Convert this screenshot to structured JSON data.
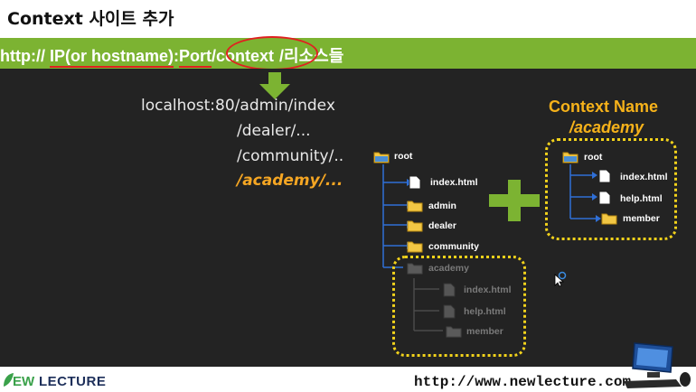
{
  "title": "Context 사이트 추가",
  "url_bar": {
    "prefix": "http:// ",
    "host": "IP(or hostname)",
    "colon": ":",
    "port": "Port",
    "context": "/context",
    "resources": "/리소스들"
  },
  "example_paths": [
    "localhost:80/admin/index",
    "/dealer/...",
    "/community/..",
    "/academy/..."
  ],
  "context_name": {
    "title": "Context Name",
    "value": "/academy"
  },
  "left_tree": {
    "root": "root",
    "items": [
      "index.html",
      "admin",
      "dealer",
      "community"
    ],
    "dim_folder": "academy",
    "dim_items": [
      "index.html",
      "help.html",
      "member"
    ]
  },
  "right_tree": {
    "root": "root",
    "items": [
      "index.html",
      "help.html",
      "member"
    ]
  },
  "footer": {
    "logo_ew": "EW",
    "logo_lecture": "LECTURE",
    "website": "http://www.newlecture.com"
  },
  "colors": {
    "green_bar": "#7cb332",
    "accent_orange": "#f6b21a",
    "highlight_red": "#e02020",
    "background_dark": "#232323",
    "tree_line": "#2f6fd6"
  }
}
